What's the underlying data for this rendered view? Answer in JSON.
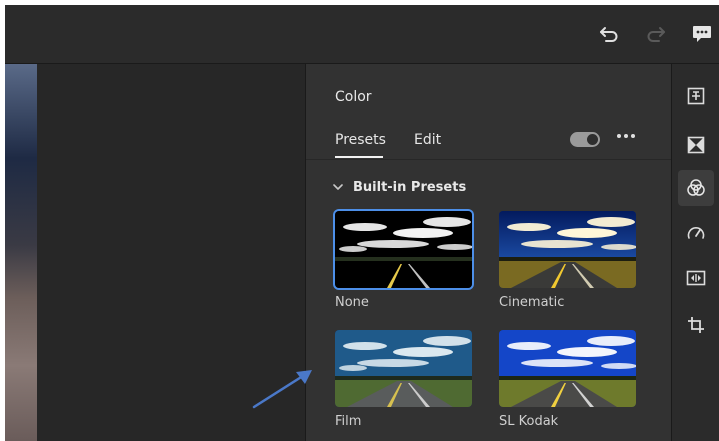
{
  "panel": {
    "title": "Color",
    "tabs": [
      {
        "label": "Presets",
        "active": true
      },
      {
        "label": "Edit",
        "active": false
      }
    ],
    "toggle_on": true
  },
  "presets_section": {
    "label": "Built-in Presets",
    "expanded": true,
    "items": [
      {
        "label": "None",
        "selected": true
      },
      {
        "label": "Cinematic",
        "selected": false
      },
      {
        "label": "Film",
        "selected": false
      },
      {
        "label": "SL Kodak",
        "selected": false
      }
    ]
  },
  "topbar": {
    "icons": [
      "undo-icon",
      "redo-icon",
      "comment-icon"
    ]
  },
  "rail": {
    "icons": [
      "light-icon",
      "effects-icon",
      "color-icon",
      "speed-icon",
      "audio-video-icon",
      "crop-icon"
    ],
    "active": "color-icon"
  },
  "colors": {
    "selection": "#4d8fe8",
    "annotation_arrow": "#4a78c8",
    "panel_bg": "#323232"
  }
}
